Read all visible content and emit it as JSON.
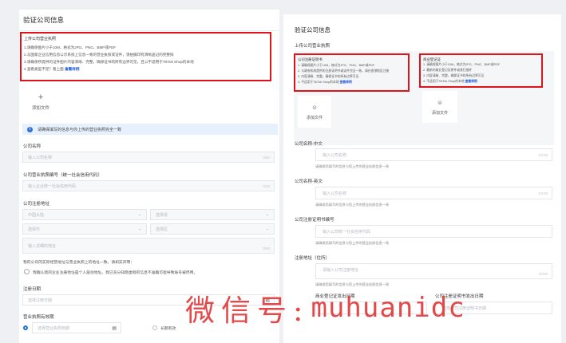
{
  "left": {
    "title": "验证公司信息",
    "license_box": {
      "heading": "上传公司营业执照",
      "lines": [
        "1.请确保图片小于10M，格式为JPG、PNG、BMP或PDF",
        "2.与国家企业信用信息公示系统上信息一致的营业执照或证件，须拍摄印有清晰盖记的完整照",
        "3.请确保所提供的证件图片内容清晰、完整，确保证书的所有边界可见，且公不适用于TikTok Shop的本地",
        "4.查看类型不足？看上面"
      ],
      "example_link": "查看样例"
    },
    "upload_label": "添加文件",
    "upload_plus": "+",
    "notice_icon": "i",
    "notice_text": "请确保填写的信息与你上传的营业执照完全一致",
    "company_name_label": "公司名称",
    "company_name_placeholder": "输入公司名称",
    "company_name_count": "0/50",
    "credit_code_label": "公司营业执照编号（统一社会信用代码）",
    "credit_code_placeholder": "输入企业统一社会信用代码",
    "credit_code_count": "0/18",
    "address_label": "公司注册地址",
    "country_value": "中国大陆",
    "province_placeholder": "选择省",
    "city_placeholder": "选择市",
    "district_placeholder": "选择区",
    "detail_address_placeholder": "输入详细的地址",
    "detail_address_count": "0/50",
    "declaration_text": "我的公司的实际经营地址与营业执照上的地址一致，请如实声明：",
    "declaration_checkbox_text": "我确认我的企业注册地址是个人居住地址，我已充分知晓虚假的信息不准确可能导致账号被停用。",
    "reg_date_label": "注册日期",
    "reg_date_placeholder": "选择注册日期",
    "validity_label": "营业执照有效期",
    "validity_placeholder": "选择营业执照到期",
    "long_term_label": "长期有效"
  },
  "right": {
    "title": "验证公司信息",
    "subtitle": "上传公司营业执照",
    "license_box": {
      "heading": "公司注册证明书",
      "lines": [
        "1. 请确保图片小于10M，格式为JPG、PNG、BMP或PDF",
        "2. 与政府机构提供的注册证明书或证件完全一致，请在香港地区注册",
        "3. 内容清晰、完整，确保证书的所有边界可见",
        "4. 不适用于TikTok Shop的本地"
      ],
      "example_link": "查看样例"
    },
    "br_box": {
      "heading": "商业登记证",
      "lines": [
        "1. 请确保图片小于10M，格式为JPG、PNG、BMP或PDF",
        "2. 最新的商业登记证原件或其扫描件",
        "3. 内容清晰、完整，确保证书的所有边界可见",
        "4. 不适用于TikTok Shop的本地"
      ],
      "example_link": "查看样例"
    },
    "upload_label": "添加文件",
    "name_cn_label": "公司名称-中文",
    "name_cn_placeholder": "输入公司名称",
    "name_cn_count": "0/100",
    "name_cn_hint": "请确保您填写的信息与您上传的营业执照信息一致",
    "name_en_label": "公司名称-英文",
    "name_en_placeholder": "输入公司名称",
    "name_en_count": "0/100",
    "name_en_hint": "请确保您填写的信息与您上传的营业执照信息一致",
    "cert_no_label": "公司注册证明书编号",
    "cert_no_placeholder": "输入公司统一社会信用代码",
    "cert_no_hint": "请确保您填写的信息与您上传的营业执照信息一致",
    "address_label": "注册地址（住所）",
    "address_placeholder": "请输入公司注册地址",
    "address_count": "0/200",
    "address_hint": "请确保您填写的信息与您上传的营业执照信息一致",
    "br_date_label": "商业登记证发出日期",
    "cert_date_label": "公司注册证明书发出日期",
    "cert_date_placeholder": "选择公司注册证明书日期"
  },
  "watermark": {
    "cn": "微信号:",
    "en": "muhuanidc"
  },
  "colors": {
    "highlight_red": "#e0121a",
    "link_blue": "#1a53d6",
    "notice_bg": "#e7f0fd",
    "watermark_red": "#e23a3a"
  }
}
